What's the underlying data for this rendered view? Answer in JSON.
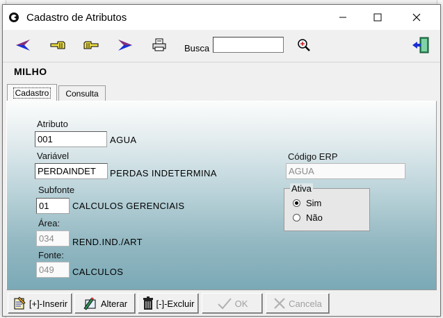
{
  "window": {
    "title": "Cadastro de Atributos"
  },
  "toolbar": {
    "busca_label": "Busca",
    "busca_value": ""
  },
  "record": {
    "title": "MILHO"
  },
  "tabs": [
    {
      "label": "Cadastro"
    },
    {
      "label": "Consulta"
    }
  ],
  "form": {
    "atributo": {
      "label": "Atributo",
      "code": "001",
      "description": "AGUA"
    },
    "variavel": {
      "label": "Variável",
      "code": "PERDAINDET",
      "description": "PERDAS INDETERMINA"
    },
    "subfonte": {
      "label": "Subfonte",
      "code": "01",
      "description": "CALCULOS GERENCIAIS"
    },
    "area": {
      "label": "Área:",
      "code": "034",
      "description": "REND.IND./ART"
    },
    "fonte": {
      "label": "Fonte:",
      "code": "049",
      "description": "CALCULOS"
    },
    "codigo_erp": {
      "label": "Código ERP",
      "value": "AGUA"
    },
    "ativa": {
      "label": "Ativa",
      "options": [
        "Sim",
        "Não"
      ],
      "selected": "Sim"
    }
  },
  "buttons": {
    "inserir": "[+]-Inserir",
    "alterar": "Alterar",
    "excluir": "[-]-Excluir",
    "ok": "OK",
    "cancela": "Cancela"
  },
  "icons": {
    "app": "app-logo-icon",
    "first": "double-arrow-left-icon",
    "prev": "hand-pointing-left-icon",
    "next": "hand-pointing-right-icon",
    "last": "double-arrow-right-icon",
    "print": "printer-icon",
    "search": "magnifier-icon",
    "exit": "exit-door-icon"
  },
  "colors": {
    "nav_arrow": "#1a2fd6",
    "panel_top": "#fbfcfc",
    "panel_bottom": "#7aa9b6",
    "exit_green": "#2e8b57"
  }
}
